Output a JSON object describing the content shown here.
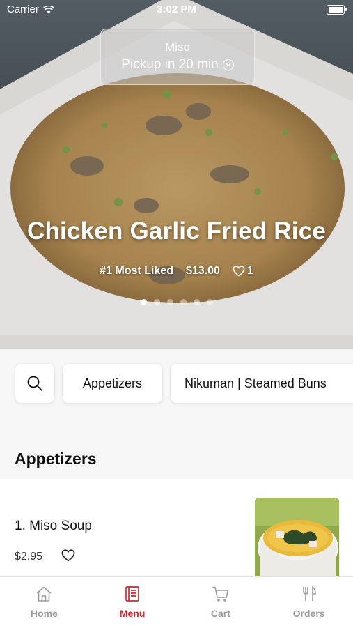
{
  "status_bar": {
    "carrier": "Carrier",
    "time": "3:02 PM"
  },
  "pickup": {
    "store": "Miso",
    "eta": "Pickup in 20 min",
    "icon": "chevron-down-circle-icon"
  },
  "hero": {
    "title": "Chicken Garlic Fried Rice",
    "rank": "#1 Most Liked",
    "price": "$13.00",
    "likes": "1",
    "page_count": 6,
    "active_page": 0
  },
  "categories": {
    "search_icon": "search-icon",
    "items": [
      "Appetizers",
      "Nikuman | Steamed Buns"
    ]
  },
  "section": {
    "title": "Appetizers"
  },
  "menu_items": [
    {
      "name": "1. Miso Soup",
      "price": "$2.95"
    }
  ],
  "tabs": [
    {
      "label": "Home",
      "icon": "home-icon",
      "active": false
    },
    {
      "label": "Menu",
      "icon": "menu-book-icon",
      "active": true
    },
    {
      "label": "Cart",
      "icon": "cart-icon",
      "active": false
    },
    {
      "label": "Orders",
      "icon": "fork-knife-icon",
      "active": false
    }
  ],
  "colors": {
    "accent": "#d4262f",
    "inactive": "#9a9a9a"
  }
}
